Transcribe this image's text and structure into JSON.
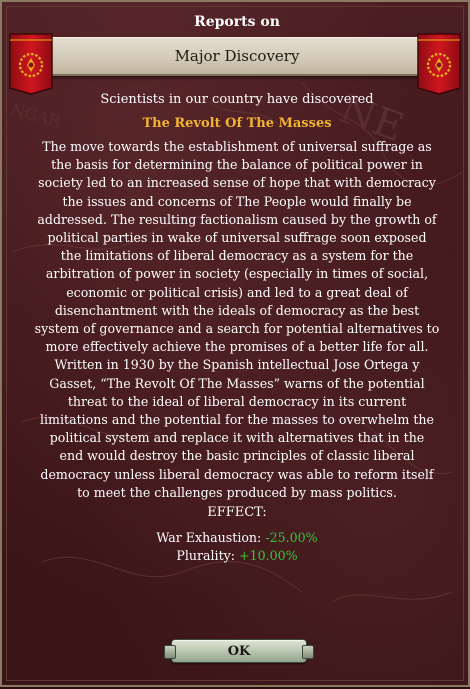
{
  "header": {
    "title": "Reports on"
  },
  "banner": {
    "title": "Major Discovery"
  },
  "event": {
    "intro": "Scientists in our country have discovered",
    "name": "The Revolt Of The Masses",
    "description_lines": [
      "The move towards the establishment of universal suffrage as",
      "the basis for determining the balance of political power in",
      "society led to an increased sense of hope that with democracy",
      "the issues and concerns of The People would finally be",
      "addressed. The resulting factionalism caused by the growth of",
      "political parties in wake of universal suffrage soon exposed",
      "the limitations of liberal democracy as a system for the",
      "arbitration of power in society (especially in times of social,",
      "economic or political crisis) and led to a great deal of",
      "disenchantment with the ideals of democracy as the best",
      "system of governance and a search for potential alternatives to",
      "more effectively achieve the promises of a better life for all.",
      "Written in 1930 by the Spanish intellectual Jose Ortega y",
      "Gasset, “The Revolt Of The Masses” warns of the potential",
      "threat to the ideal of liberal democracy in its current",
      "limitations and the potential for the masses to overwhelm the",
      "political system and replace it with alternatives that in the",
      "end would destroy the basic principles of classic liberal",
      "democracy unless liberal democracy was able to reform itself",
      "to meet the challenges produced by mass politics."
    ]
  },
  "effects": {
    "label": "EFFECT:",
    "items": [
      {
        "name": "War Exhaustion:",
        "value": "-25.00%"
      },
      {
        "name": "Plurality:",
        "value": "+10.00%"
      }
    ]
  },
  "buttons": {
    "ok_label": "OK"
  },
  "map_text": {
    "north": "NE",
    "west": "NGAR"
  },
  "icons": {
    "left_flag": "red-laurel-flag-icon",
    "right_flag": "red-laurel-flag-icon"
  },
  "colors": {
    "background": "#3e1619",
    "event_name": "#f2b233",
    "effect_value": "#35c43a",
    "flag_red": "#c0141c",
    "flag_emblem": "#e8b21e"
  }
}
